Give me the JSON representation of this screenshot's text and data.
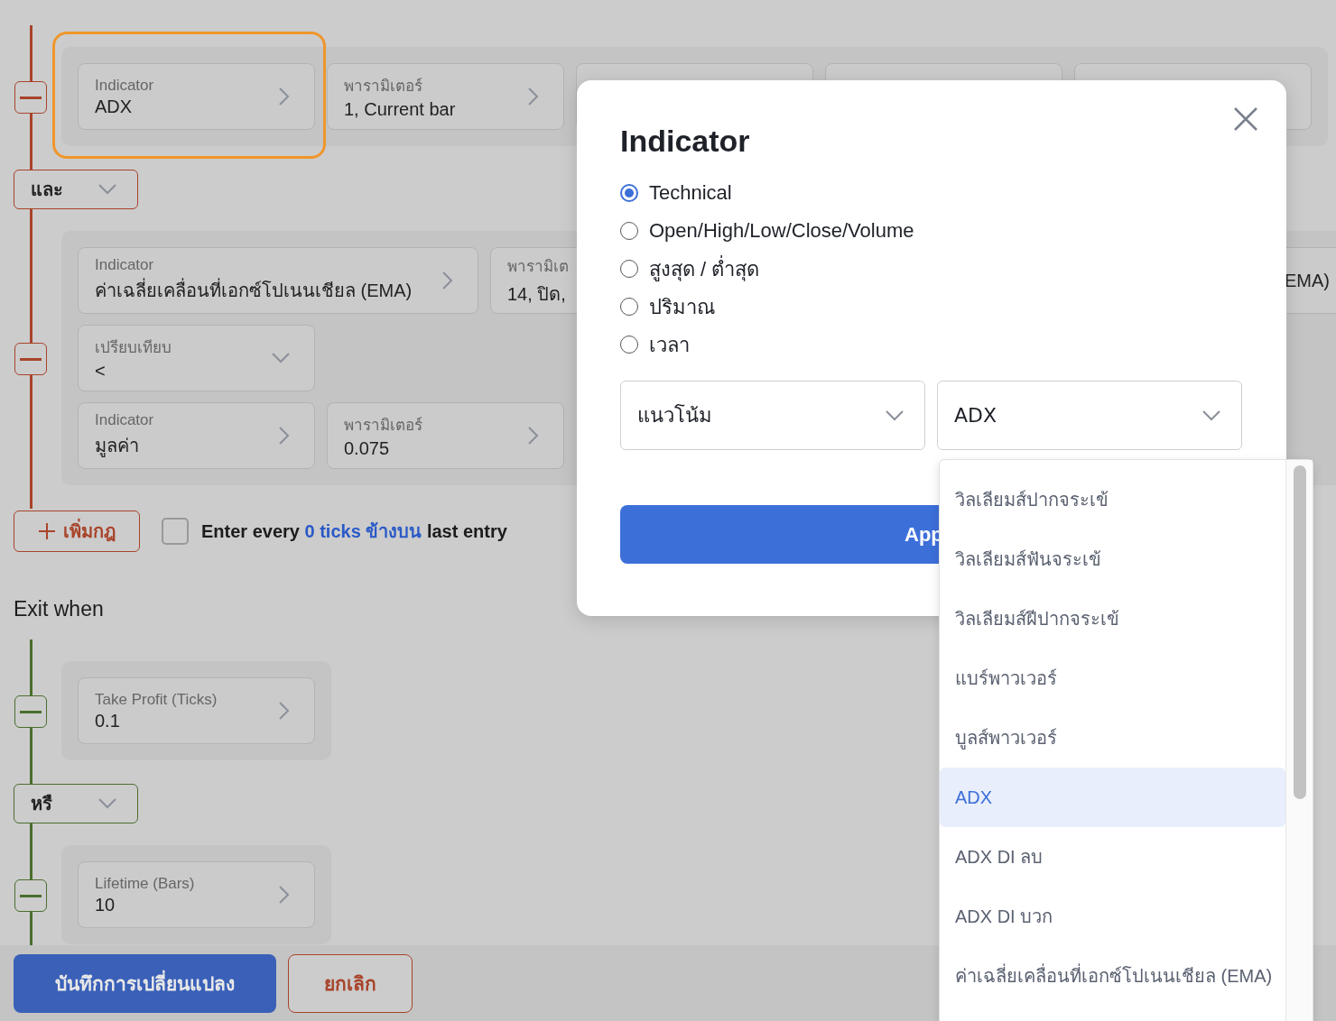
{
  "entry": {
    "items": [
      {
        "kind": "rule",
        "rows": [
          {
            "cards": [
              {
                "kind": "picker",
                "label": "Indicator",
                "value": "ADX",
                "highlighted": true
              },
              {
                "kind": "picker",
                "label": "พารามิเตอร์",
                "value": "1, Current bar",
                "highlighted": false
              },
              {
                "kind": "covered"
              },
              {
                "kind": "covered"
              },
              {
                "kind": "covered"
              }
            ]
          }
        ]
      },
      {
        "kind": "connector",
        "value": "และ"
      },
      {
        "kind": "rule",
        "rows": [
          {
            "cards": [
              {
                "kind": "picker",
                "label": "Indicator",
                "value": "ค่าเฉลี่ยเคลื่อนที่เอกซ์โปเนนเชียล (EMA)",
                "highlighted": false,
                "wide": true
              },
              {
                "kind": "cut",
                "label": "พารามิเต",
                "value": "14, ปิด,"
              },
              {
                "kind": "tail",
                "value": "EMA)"
              }
            ]
          },
          {
            "cards": [
              {
                "kind": "select",
                "label": "เปรียบเทียบ",
                "value": "<",
                "highlighted": false
              }
            ]
          },
          {
            "cards": [
              {
                "kind": "picker",
                "label": "Indicator",
                "value": "มูลค่า",
                "highlighted": false
              },
              {
                "kind": "picker",
                "label": "พารามิเตอร์",
                "value": "0.075",
                "highlighted": false
              }
            ]
          }
        ]
      }
    ],
    "add_rule_button": "เพิ่มกฎ",
    "repeat_option": {
      "checked": false,
      "before": "Enter every",
      "link": "0 ticks ข้างบน",
      "after": "last entry"
    }
  },
  "exit": {
    "title": "Exit when",
    "items": [
      {
        "kind": "rule",
        "rows": [
          {
            "cards": [
              {
                "kind": "picker",
                "label": "Take Profit (Ticks)",
                "value": "0.1",
                "highlighted": false
              }
            ]
          }
        ]
      },
      {
        "kind": "connector",
        "value": "หรื"
      },
      {
        "kind": "rule",
        "rows": [
          {
            "cards": [
              {
                "kind": "picker",
                "label": "Lifetime (Bars)",
                "value": "10",
                "highlighted": false
              }
            ]
          }
        ]
      }
    ]
  },
  "footer": {
    "save_button": "บันทึกการเปลี่ยนแปลง",
    "cancel_button": "ยกเลิก"
  },
  "dialog": {
    "title": "Indicator",
    "options": [
      {
        "label": "Technical",
        "selected": true
      },
      {
        "label": "Open/High/Low/Close/Volume",
        "selected": false
      },
      {
        "label": "สูงสุด / ต่ำสุด",
        "selected": false
      },
      {
        "label": "ปริมาณ",
        "selected": false
      },
      {
        "label": "เวลา",
        "selected": false
      }
    ],
    "category_select": "แนวโน้ม",
    "indicator_select": "ADX",
    "apply_button": "App"
  },
  "dropdown": {
    "items": [
      {
        "label": "วิลเลียมส์ปากจระเข้",
        "selected": false
      },
      {
        "label": "วิลเลียมส์ฟันจระเข้",
        "selected": false
      },
      {
        "label": "วิลเลียมส์ฝีปากจระเข้",
        "selected": false
      },
      {
        "label": "แบร์พาวเวอร์",
        "selected": false
      },
      {
        "label": "บูลส์พาวเวอร์",
        "selected": false
      },
      {
        "label": "ADX",
        "selected": true
      },
      {
        "label": "ADX DI ลบ",
        "selected": false
      },
      {
        "label": "ADX DI บวก",
        "selected": false
      },
      {
        "label": "ค่าเฉลี่ยเคลื่อนที่เอกซ์โปเนนเชียล (EMA)",
        "selected": false
      }
    ]
  }
}
